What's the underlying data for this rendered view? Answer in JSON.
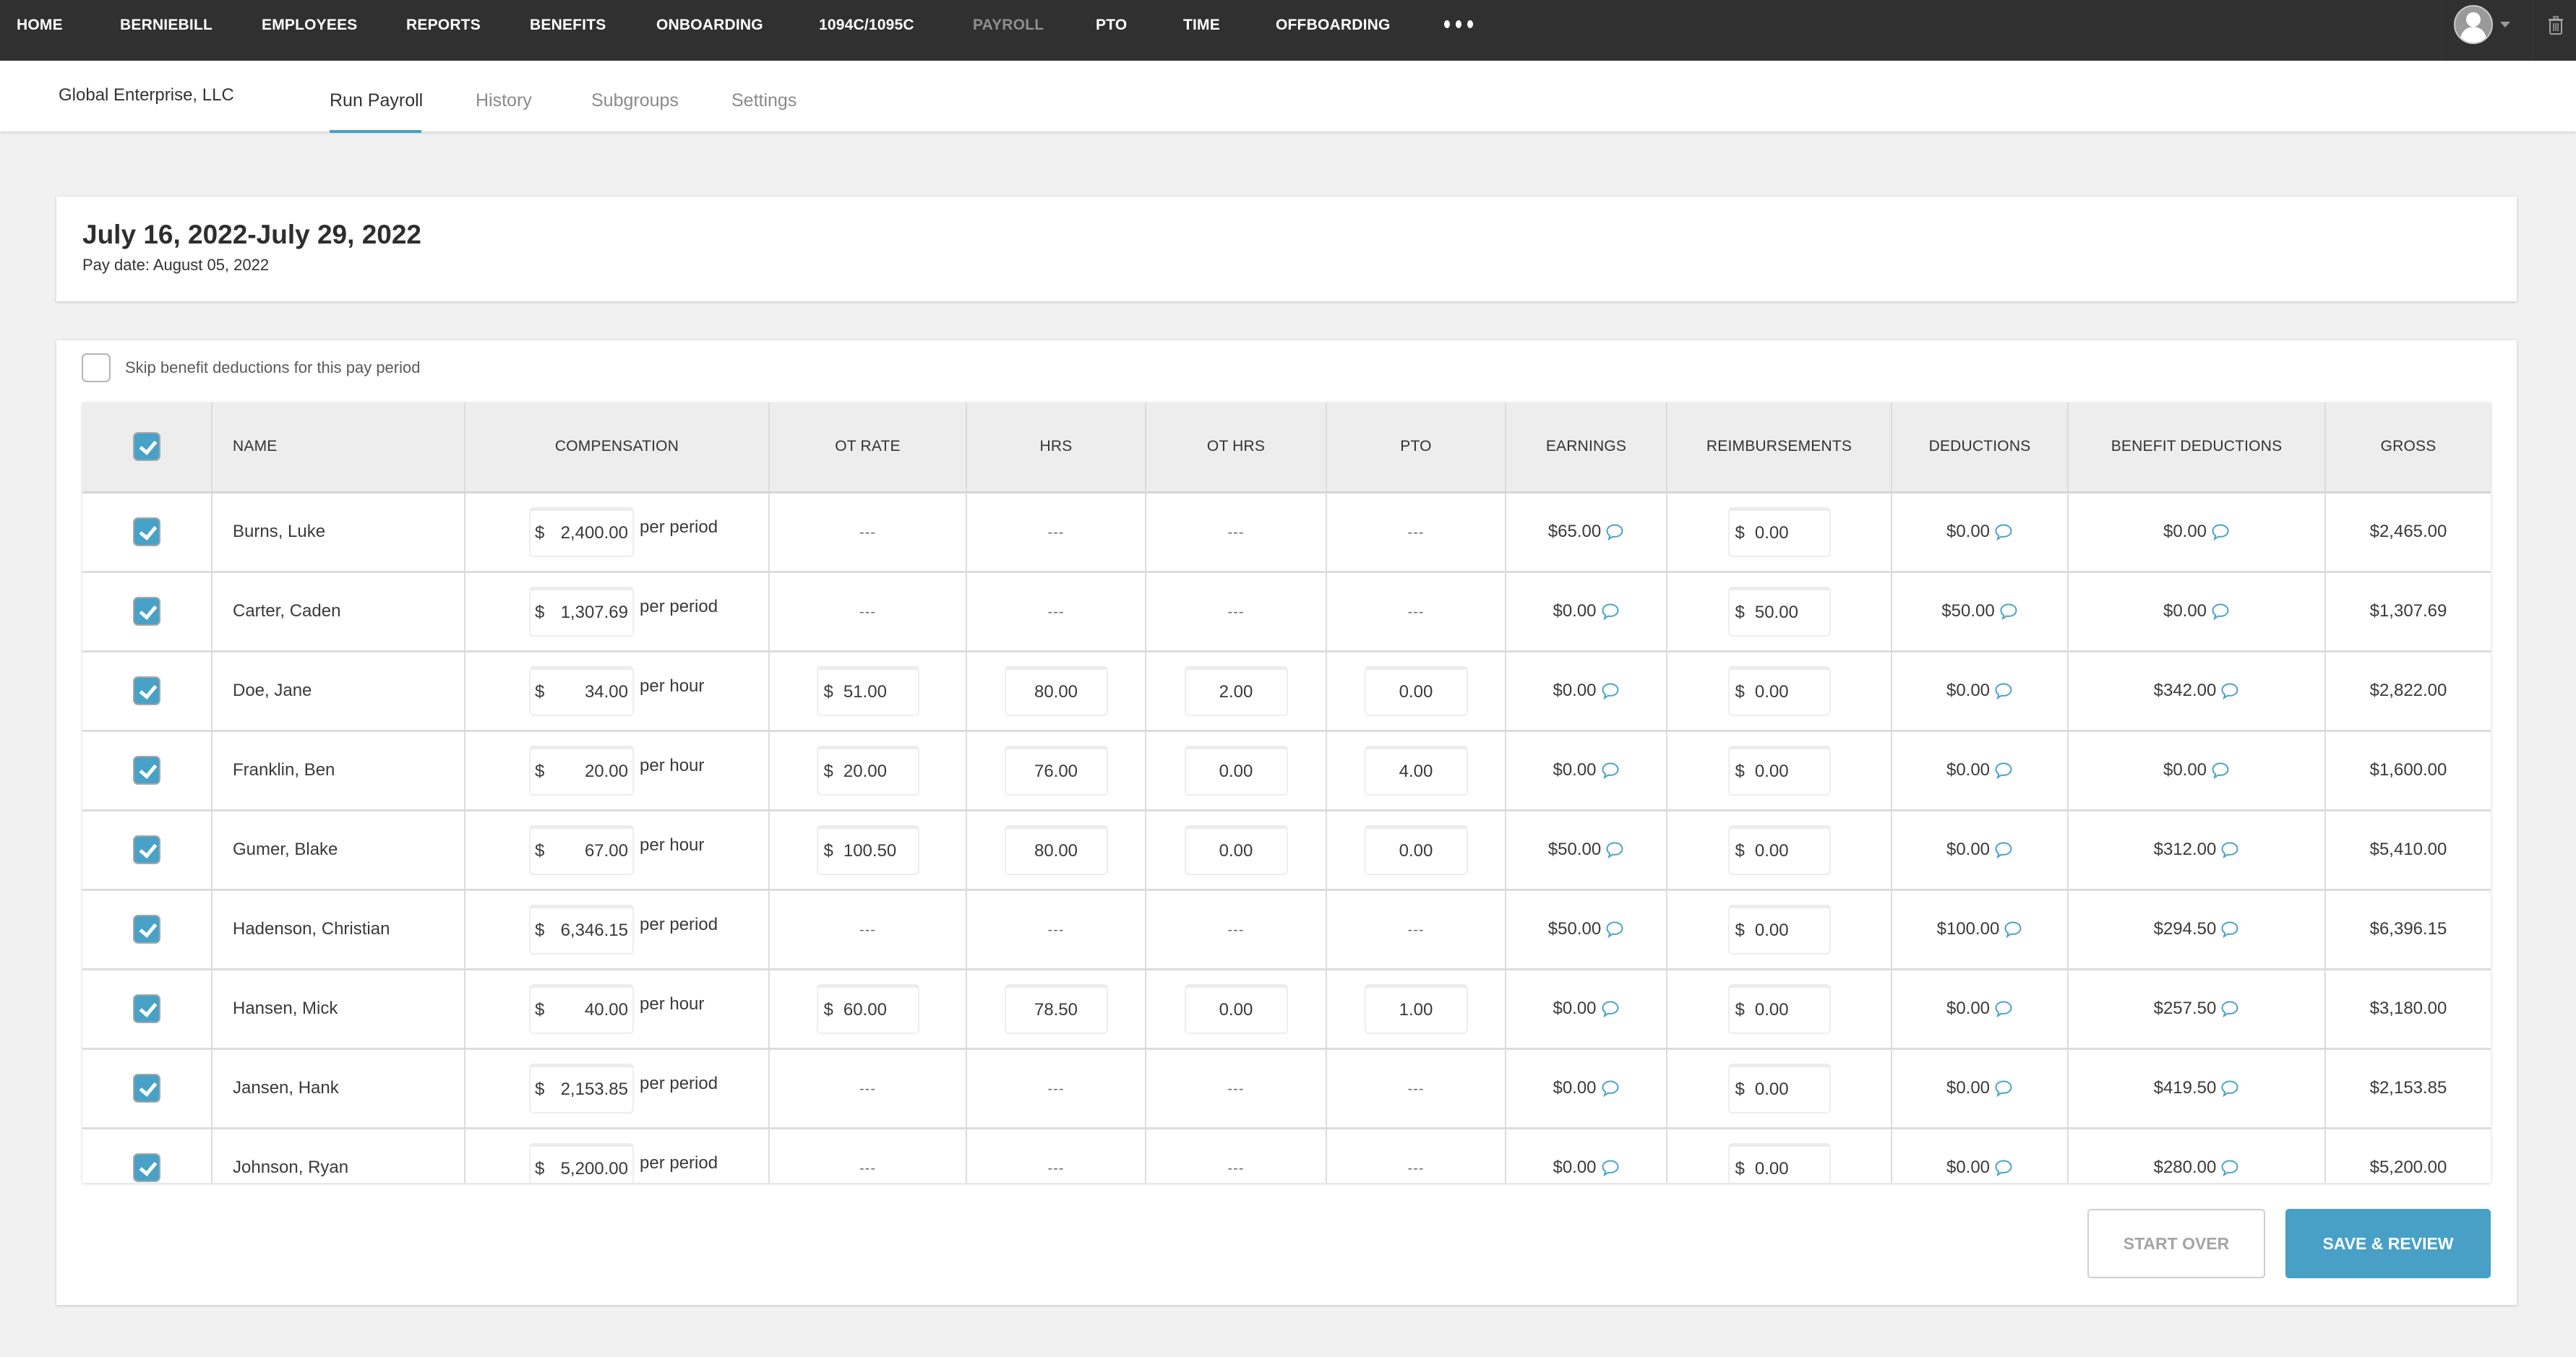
{
  "topnav": {
    "items": [
      {
        "label": "HOME",
        "active": false
      },
      {
        "label": "BERNIEBILL",
        "active": false
      },
      {
        "label": "EMPLOYEES",
        "active": false
      },
      {
        "label": "REPORTS",
        "active": false
      },
      {
        "label": "BENEFITS",
        "active": false
      },
      {
        "label": "ONBOARDING",
        "active": false
      },
      {
        "label": "1094C/1095C",
        "active": false
      },
      {
        "label": "PAYROLL",
        "active": true
      },
      {
        "label": "PTO",
        "active": false
      },
      {
        "label": "TIME",
        "active": false
      },
      {
        "label": "OFFBOARDING",
        "active": false
      }
    ],
    "more_icon": "ellipsis-icon",
    "user_icon": "avatar-icon",
    "trash_icon": "trash-icon"
  },
  "subnav": {
    "company": "Global Enterprise, LLC",
    "tabs": [
      {
        "label": "Run Payroll",
        "active": true
      },
      {
        "label": "History",
        "active": false
      },
      {
        "label": "Subgroups",
        "active": false
      },
      {
        "label": "Settings",
        "active": false
      }
    ]
  },
  "period": {
    "title": "July 16, 2022-July 29, 2022",
    "pay_date": "Pay date: August 05, 2022"
  },
  "skip_benefits": {
    "label": "Skip benefit deductions for this pay period",
    "checked": false
  },
  "table": {
    "headers": [
      "NAME",
      "COMPENSATION",
      "OT RATE",
      "HRS",
      "OT HRS",
      "PTO",
      "EARNINGS",
      "REIMBURSEMENTS",
      "DEDUCTIONS",
      "BENEFIT DEDUCTIONS",
      "GROSS"
    ],
    "select_all_checked": true,
    "currency_symbol": "$",
    "empty_value": "---",
    "rows": [
      {
        "name": "Burns, Luke",
        "compensation": "2,400.00",
        "unit": "per period",
        "ot_rate": null,
        "hrs": null,
        "ot_hrs": null,
        "pto": null,
        "earnings": "$65.00",
        "reimbursements": "0.00",
        "deductions": "$0.00",
        "benefit_deductions": "$0.00",
        "gross": "$2,465.00",
        "checked": true
      },
      {
        "name": "Carter, Caden",
        "compensation": "1,307.69",
        "unit": "per period",
        "ot_rate": null,
        "hrs": null,
        "ot_hrs": null,
        "pto": null,
        "earnings": "$0.00",
        "reimbursements": "50.00",
        "deductions": "$50.00",
        "benefit_deductions": "$0.00",
        "gross": "$1,307.69",
        "checked": true
      },
      {
        "name": "Doe, Jane",
        "compensation": "34.00",
        "unit": "per hour",
        "ot_rate": "51.00",
        "hrs": "80.00",
        "ot_hrs": "2.00",
        "pto": "0.00",
        "earnings": "$0.00",
        "reimbursements": "0.00",
        "deductions": "$0.00",
        "benefit_deductions": "$342.00",
        "gross": "$2,822.00",
        "checked": true
      },
      {
        "name": "Franklin, Ben",
        "compensation": "20.00",
        "unit": "per hour",
        "ot_rate": "20.00",
        "hrs": "76.00",
        "ot_hrs": "0.00",
        "pto": "4.00",
        "earnings": "$0.00",
        "reimbursements": "0.00",
        "deductions": "$0.00",
        "benefit_deductions": "$0.00",
        "gross": "$1,600.00",
        "checked": true
      },
      {
        "name": "Gumer, Blake",
        "compensation": "67.00",
        "unit": "per hour",
        "ot_rate": "100.50",
        "hrs": "80.00",
        "ot_hrs": "0.00",
        "pto": "0.00",
        "earnings": "$50.00",
        "reimbursements": "0.00",
        "deductions": "$0.00",
        "benefit_deductions": "$312.00",
        "gross": "$5,410.00",
        "checked": true
      },
      {
        "name": "Hadenson, Christian",
        "compensation": "6,346.15",
        "unit": "per period",
        "ot_rate": null,
        "hrs": null,
        "ot_hrs": null,
        "pto": null,
        "earnings": "$50.00",
        "reimbursements": "0.00",
        "deductions": "$100.00",
        "benefit_deductions": "$294.50",
        "gross": "$6,396.15",
        "checked": true
      },
      {
        "name": "Hansen, Mick",
        "compensation": "40.00",
        "unit": "per hour",
        "ot_rate": "60.00",
        "hrs": "78.50",
        "ot_hrs": "0.00",
        "pto": "1.00",
        "earnings": "$0.00",
        "reimbursements": "0.00",
        "deductions": "$0.00",
        "benefit_deductions": "$257.50",
        "gross": "$3,180.00",
        "checked": true
      },
      {
        "name": "Jansen, Hank",
        "compensation": "2,153.85",
        "unit": "per period",
        "ot_rate": null,
        "hrs": null,
        "ot_hrs": null,
        "pto": null,
        "earnings": "$0.00",
        "reimbursements": "0.00",
        "deductions": "$0.00",
        "benefit_deductions": "$419.50",
        "gross": "$2,153.85",
        "checked": true
      },
      {
        "name": "Johnson, Ryan",
        "compensation": "5,200.00",
        "unit": "per period",
        "ot_rate": null,
        "hrs": null,
        "ot_hrs": null,
        "pto": null,
        "earnings": "$0.00",
        "reimbursements": "0.00",
        "deductions": "$0.00",
        "benefit_deductions": "$280.00",
        "gross": "$5,200.00",
        "checked": true
      }
    ]
  },
  "actions": {
    "start_over": "START OVER",
    "save_review": "SAVE & REVIEW"
  },
  "colors": {
    "topbar": "#303030",
    "accent": "#48a0c6",
    "page_bg": "#f1f1f1",
    "header_bg": "#ededed"
  }
}
